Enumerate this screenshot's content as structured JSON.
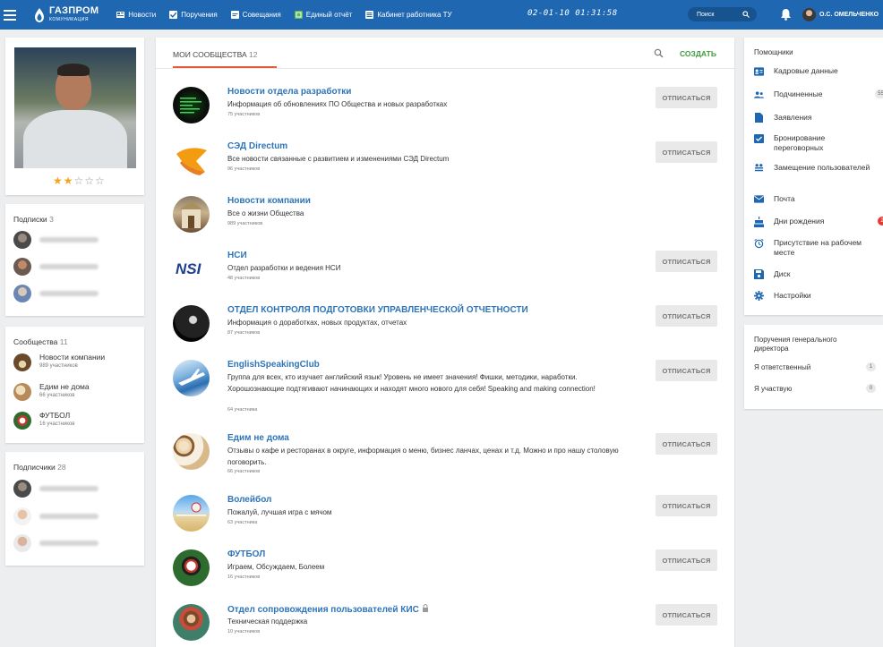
{
  "topbar": {
    "logo_main": "ГАЗПРОМ",
    "logo_sub": "КОМУНИКАЦИЯ",
    "nav": [
      {
        "label": "Новости",
        "icon": "news-icon",
        "color": "#ffffff"
      },
      {
        "label": "Поручения",
        "icon": "checkbox-icon",
        "color": "#ffffff"
      },
      {
        "label": "Совещания",
        "icon": "meeting-icon",
        "color": "#ffffff"
      },
      {
        "label": "Единый отчёт",
        "icon": "report-icon",
        "color": "#5cb85c"
      },
      {
        "label": "Кабинет работника ТУ",
        "icon": "cabinet-icon",
        "color": "#ffffff"
      }
    ],
    "clock": "02-01-10 01:31:58",
    "search_placeholder": "Поиск",
    "user_name": "О.С. ОМЕЛЬЧЕНКО"
  },
  "profile": {
    "rating": 2,
    "rating_max": 5,
    "stars": "★★☆☆☆"
  },
  "subscriptions": {
    "title": "Подписки",
    "count": "3"
  },
  "communities": {
    "title": "Сообщества",
    "count": "11",
    "items": [
      {
        "name": "Новости компании",
        "sub": "989 участников"
      },
      {
        "name": "Едим не дома",
        "sub": "66 участников"
      },
      {
        "name": "ФУТБОЛ",
        "sub": "16 участников"
      }
    ]
  },
  "subscribers": {
    "title": "Подписчики",
    "count": "28"
  },
  "main": {
    "tab_label": "МОИ СООБЩЕСТВА",
    "tab_count": "12",
    "create_label": "СОЗДАТЬ",
    "unsubscribe_label": "ОТПИСАТЬСЯ",
    "groups": [
      {
        "name": "Новости отдела разработки",
        "desc": "Информация об обновлениях ПО Общества и новых разработках",
        "members": "75 участников",
        "unsubscribe": true
      },
      {
        "name": "СЭД Directum",
        "desc": "Все новости связанные с развитием и изменениями СЭД Directum",
        "members": "96 участников",
        "unsubscribe": true
      },
      {
        "name": "Новости компании",
        "desc": "Все о жизни Общества",
        "members": "989 участников",
        "unsubscribe": false
      },
      {
        "name": "НСИ",
        "desc": "Отдел разработки и ведения НСИ",
        "members": "48 участников",
        "unsubscribe": true
      },
      {
        "name": "ОТДЕЛ КОНТРОЛЯ ПОДГОТОВКИ УПРАВЛЕНЧЕСКОЙ ОТЧЕТНОСТИ",
        "desc": "Информация о доработках, новых продуктах, отчетах",
        "members": "87 участников",
        "unsubscribe": true
      },
      {
        "name": "EnglishSpeakingClub",
        "desc": "Группа для всех, кто изучает английский язык! Уровень не имеет значения! Фишки, методики, наработки. Хорошознающие подтягивают начинающих и находят много нового для себя! Speaking and making connection!",
        "members": "64 участника",
        "unsubscribe": true
      },
      {
        "name": "Едим не дома",
        "desc": "Отзывы о кафе и ресторанах в округе, информация о меню, бизнес ланчах, ценах и т.д. Можно и про нашу столовую поговорить.",
        "members": "66 участников",
        "unsubscribe": true
      },
      {
        "name": "Волейбол",
        "desc": "Пожалуй, лучшая игра с мячом",
        "members": "63 участника",
        "unsubscribe": true
      },
      {
        "name": "ФУТБОЛ",
        "desc": "Играем, Обсуждаем, Болеем",
        "members": "16 участников",
        "unsubscribe": true
      },
      {
        "name": "Отдел сопровождения пользователей КИС",
        "desc": "Техническая поддержка",
        "members": "10 участников",
        "unsubscribe": true
      }
    ]
  },
  "helpers": {
    "title": "Помощники",
    "items": [
      {
        "label": "Кадровые данные",
        "icon": "id-card-icon"
      },
      {
        "label": "Подчиненные",
        "icon": "people-icon",
        "badge": "55"
      },
      {
        "label": "Заявления",
        "icon": "document-icon"
      },
      {
        "label": "Бронирование переговорных",
        "icon": "calendar-check-icon"
      },
      {
        "label": "Замещение пользователей",
        "icon": "swap-users-icon"
      },
      {
        "label": "Почта",
        "icon": "mail-icon"
      },
      {
        "label": "Дни рождения",
        "icon": "cake-icon",
        "badge": "2"
      },
      {
        "label": "Присутствие на рабочем месте",
        "icon": "alarm-icon"
      },
      {
        "label": "Диск",
        "icon": "floppy-icon"
      },
      {
        "label": "Настройки",
        "icon": "gear-icon"
      }
    ]
  },
  "orders": {
    "title": "Поручения генерального директора",
    "items": [
      {
        "label": "Я ответственный",
        "badge": "1"
      },
      {
        "label": "Я участвую",
        "badge": "0"
      }
    ]
  },
  "colors": {
    "topbar": "#1f67b1",
    "link": "#2e75b8",
    "accent": "#e35b3b",
    "create": "#3d9d3d",
    "star": "#f4a51c",
    "badge_red": "#e53935"
  }
}
